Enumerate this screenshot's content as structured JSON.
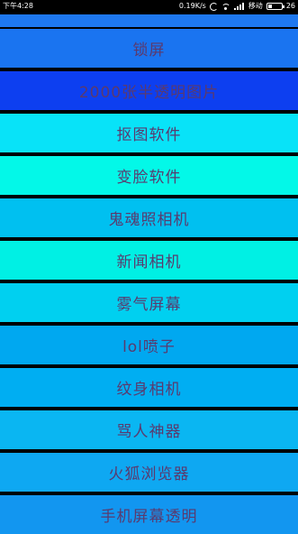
{
  "status_bar": {
    "time": "下午4:28",
    "net_speed": "0.19K/s",
    "carrier": "移动",
    "battery": "26",
    "battery_level": 0.26
  },
  "menu": {
    "items": [
      {
        "label": "锁屏",
        "color": "#1a74f0"
      },
      {
        "label": "2000张半透明图片",
        "color": "#0d3ff0"
      },
      {
        "label": "抠图软件",
        "color": "#08e3f8"
      },
      {
        "label": "变脸软件",
        "color": "#03f8e8"
      },
      {
        "label": "鬼魂照相机",
        "color": "#00c0f0"
      },
      {
        "label": "新闻相机",
        "color": "#00f0e4"
      },
      {
        "label": "雾气屏幕",
        "color": "#00d0f0"
      },
      {
        "label": "lol喷子",
        "color": "#00a8f0"
      },
      {
        "label": "纹身相机",
        "color": "#00aef2"
      },
      {
        "label": "骂人神器",
        "color": "#0ab6f2"
      },
      {
        "label": "火狐浏览器",
        "color": "#0ea8f2"
      },
      {
        "label": "手机屏幕透明",
        "color": "#1296f0"
      }
    ]
  }
}
